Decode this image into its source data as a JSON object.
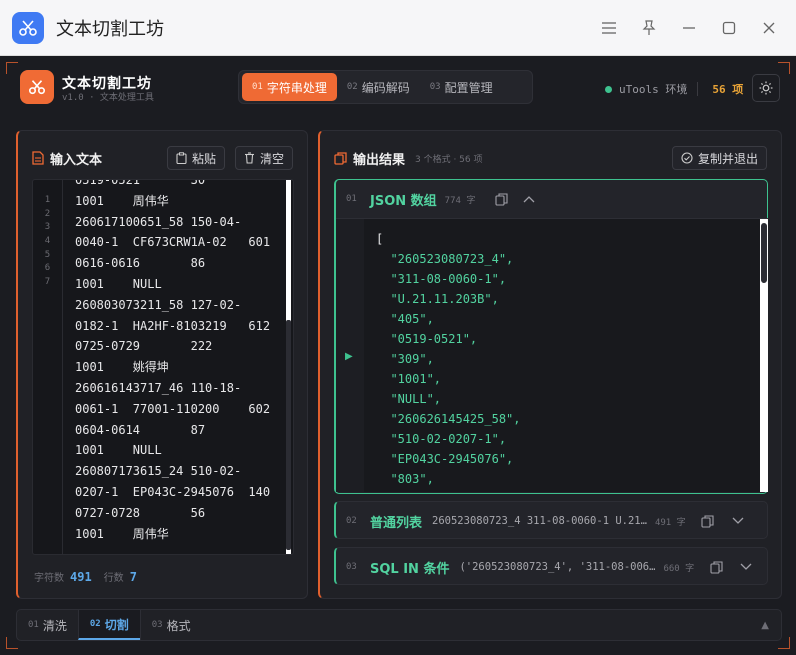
{
  "window": {
    "title": "文本切割工坊"
  },
  "header": {
    "brand_title": "文本切割工坊",
    "brand_sub": "v1.0 · 文本处理工具",
    "tabs": [
      {
        "num": "01",
        "label": "字符串处理"
      },
      {
        "num": "02",
        "label": "编码解码"
      },
      {
        "num": "03",
        "label": "配置管理"
      }
    ],
    "env_label": "uTools 环境",
    "count_label": "56 项"
  },
  "input_panel": {
    "title": "输入文本",
    "paste_label": "粘贴",
    "clear_label": "清空",
    "line_numbers": [
      "1",
      "2",
      "3",
      "4",
      "5",
      "6",
      "7"
    ],
    "text": "0519-0521       30\n1001    周伟华\n260617100651_58 150-04-\n0040-1  CF673CRW1A-02   601\n0616-0616       86\n1001    NULL\n260803073211_58 127-02-\n0182-1  HA2HF-8103219   612\n0725-0729       222\n1001    姚得坤\n260616143717_46 110-18-\n0061-1  77001-110200    602\n0604-0614       87\n1001    NULL\n260807173615_24 510-02-\n0207-1  EP043C-2945076  140\n0727-0728       56\n1001    周伟华",
    "char_label": "字符数",
    "char_count": "491",
    "line_label": "行数",
    "line_count": "7"
  },
  "output_panel": {
    "title": "输出结果",
    "meta": "3 个格式 · 56 项",
    "copy_exit_label": "复制并退出",
    "cards": [
      {
        "num": "01",
        "title": "JSON 数组",
        "size": "774 字",
        "open_bracket": "[",
        "items": [
          "\"260523080723_4\",",
          "\"311-08-0060-1\",",
          "\"U.21.11.203B\",",
          "\"405\",",
          "\"0519-0521\",",
          "\"309\",",
          "\"1001\",",
          "\"NULL\",",
          "\"260626145425_58\",",
          "\"510-02-0207-1\",",
          "\"EP043C-2945076\",",
          "\"803\","
        ]
      },
      {
        "num": "02",
        "title": "普通列表",
        "preview": "260523080723_4 311-08-0060-1 U.21…",
        "size": "491 字"
      },
      {
        "num": "03",
        "title": "SQL IN 条件",
        "preview": "('260523080723_4', '311-08-006…",
        "size": "660 字"
      }
    ]
  },
  "bottom_tabs": [
    {
      "num": "01",
      "label": "清洗"
    },
    {
      "num": "02",
      "label": "切割"
    },
    {
      "num": "03",
      "label": "格式"
    }
  ],
  "colors": {
    "accent": "#ef6a34",
    "success": "#3ec28f",
    "info": "#5da8e8"
  }
}
